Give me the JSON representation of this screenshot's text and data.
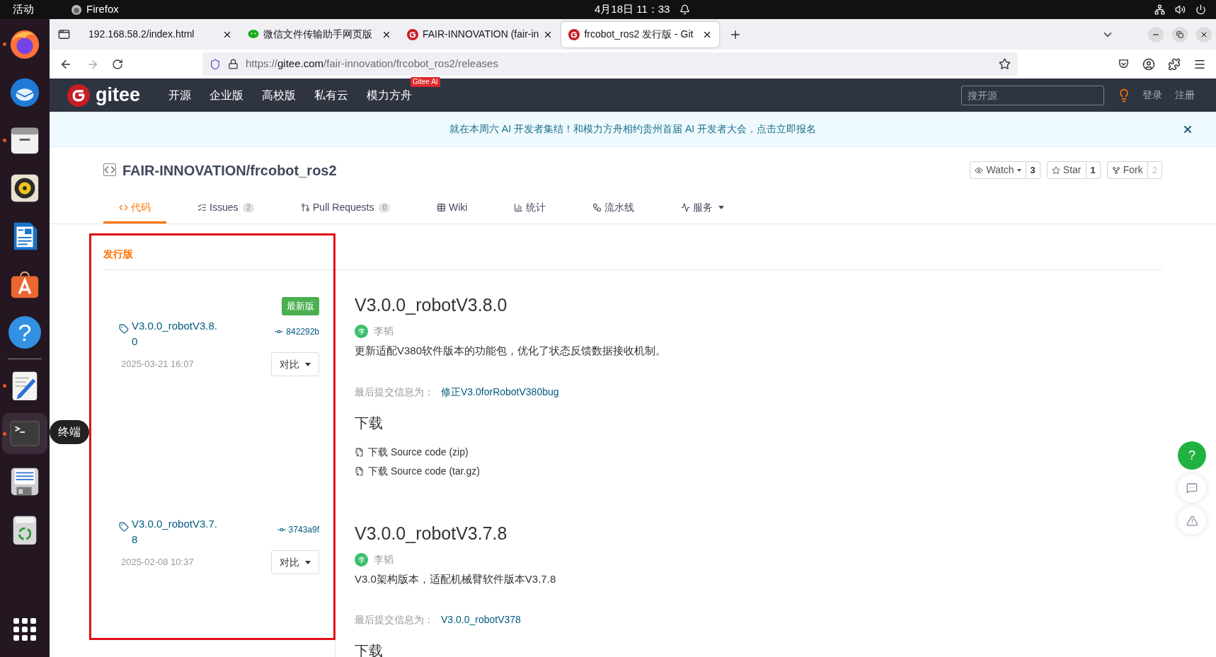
{
  "system_bar": {
    "activities": "活动",
    "app": "Firefox",
    "clock": "4月18日  11：33"
  },
  "dock": {
    "items": [
      {
        "kind": "browser",
        "running": true,
        "focused": false
      },
      {
        "kind": "mail",
        "running": false,
        "focused": false
      },
      {
        "kind": "files",
        "running": true,
        "focused": false
      },
      {
        "kind": "speaker",
        "running": false,
        "focused": false
      },
      {
        "kind": "document",
        "running": false,
        "focused": false
      },
      {
        "kind": "store",
        "running": false,
        "focused": false
      },
      {
        "kind": "help",
        "glyph": "?",
        "running": false,
        "focused": false
      },
      {
        "kind": "separator"
      },
      {
        "kind": "editor",
        "running": true,
        "focused": false
      },
      {
        "kind": "terminal",
        "running": true,
        "focused": true
      },
      {
        "kind": "floppy",
        "running": false,
        "focused": false
      },
      {
        "kind": "trash",
        "running": false,
        "focused": false
      }
    ],
    "tooltip": "终端"
  },
  "browser": {
    "tabs": [
      {
        "kind": "plain",
        "title": "192.168.58.2/index.html",
        "selected": false
      },
      {
        "kind": "chat",
        "title": "微信文件传输助手网页版",
        "selected": false
      },
      {
        "kind": "gitee",
        "title": "FAIR-INNOVATION (fair-in",
        "selected": false
      },
      {
        "kind": "gitee",
        "title": "frcobot_ros2 发行版 - Git",
        "selected": true
      }
    ],
    "url": {
      "prefix": "https://",
      "host": "gitee.com",
      "path": "/fair-innovation/frcobot_ros2/releases"
    }
  },
  "gitee_nav": {
    "logo_text": "gitee",
    "links": [
      {
        "label": "开源"
      },
      {
        "label": "企业版"
      },
      {
        "label": "高校版"
      },
      {
        "label": "私有云"
      },
      {
        "label": "模力方舟",
        "badge": "Gitee AI"
      }
    ],
    "search_placeholder": "搜开源",
    "login": "登录",
    "register": "注册"
  },
  "banner": {
    "text": "就在本周六 AI 开发者集结！和模力方舟相约贵州首届 AI 开发者大会，点击立即报名"
  },
  "repo": {
    "path": "FAIR-INNOVATION/frcobot_ros2",
    "actions": [
      {
        "kind": "watch",
        "label": "Watch",
        "count": "3",
        "disabled": false
      },
      {
        "kind": "star",
        "label": "Star",
        "count": "1",
        "disabled": false
      },
      {
        "kind": "fork",
        "label": "Fork",
        "count": "2",
        "disabled": true
      }
    ],
    "tabs": [
      {
        "kind": "code",
        "label": "代码",
        "selected": true
      },
      {
        "kind": "issues",
        "label": "Issues",
        "count": "2",
        "selected": false
      },
      {
        "kind": "pulls",
        "label": "Pull Requests",
        "count": "0",
        "selected": false
      },
      {
        "kind": "wiki",
        "label": "Wiki",
        "selected": false
      },
      {
        "kind": "stats",
        "label": "统计",
        "selected": false
      },
      {
        "kind": "pipeline",
        "label": "流水线",
        "selected": false
      },
      {
        "kind": "service",
        "label": "服务",
        "selected": false
      }
    ]
  },
  "releases": {
    "heading": "发行版",
    "items": [
      {
        "tag": "V3.0.0_robotV3.8.0",
        "latest_badge": "最新版",
        "commit": "842292b",
        "date": "2025-03-21 16:07",
        "compare": "对比",
        "title": "V3.0.0_robotV3.8.0",
        "avatar": "李",
        "author": "李韬",
        "description": "更新适配V380软件版本的功能包，优化了状态反馈数据接收机制。",
        "last_commit_label": "最后提交信息为：",
        "last_commit": "修正V3.0forRobotV380bug",
        "downloads_heading": "下载",
        "downloads": [
          "下载 Source code (zip)",
          "下载 Source code (tar.gz)"
        ]
      },
      {
        "tag": "V3.0.0_robotV3.7.8",
        "commit": "3743a9f",
        "date": "2025-02-08 10:37",
        "compare": "对比",
        "title": "V3.0.0_robotV3.7.8",
        "avatar": "李",
        "author": "李韬",
        "description": "V3.0架构版本，适配机械臂软件版本V3.7.8",
        "last_commit_label": "最后提交信息为：",
        "last_commit": "V3.0.0_robotV378",
        "downloads_heading": "下载"
      }
    ]
  },
  "help_button": "?"
}
